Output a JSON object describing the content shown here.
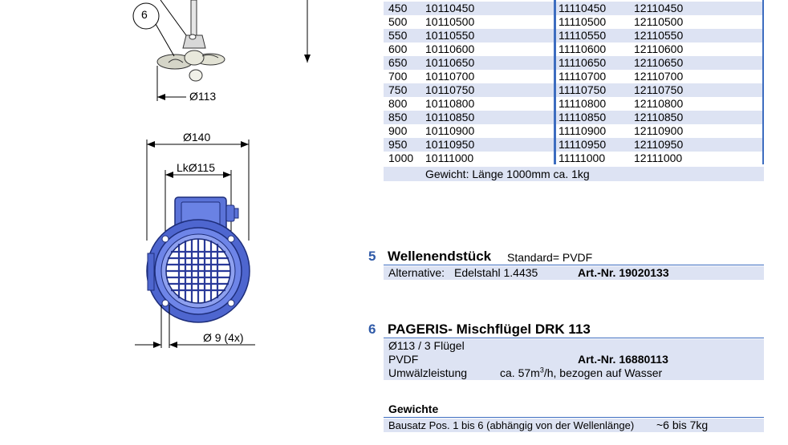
{
  "drawing": {
    "item_bubble": "6",
    "mixer_diameter": "Ø113",
    "motor_diameter": "Ø140",
    "bolt_circle": "LkØ115",
    "hole_spec": "Ø 9 (4x)"
  },
  "shaft_table": {
    "rows": [
      {
        "length": "450",
        "a": "10110450",
        "b": "11110450",
        "c": "12110450"
      },
      {
        "length": "500",
        "a": "10110500",
        "b": "11110500",
        "c": "12110500"
      },
      {
        "length": "550",
        "a": "10110550",
        "b": "11110550",
        "c": "12110550"
      },
      {
        "length": "600",
        "a": "10110600",
        "b": "11110600",
        "c": "12110600"
      },
      {
        "length": "650",
        "a": "10110650",
        "b": "11110650",
        "c": "12110650"
      },
      {
        "length": "700",
        "a": "10110700",
        "b": "11110700",
        "c": "12110700"
      },
      {
        "length": "750",
        "a": "10110750",
        "b": "11110750",
        "c": "12110750"
      },
      {
        "length": "800",
        "a": "10110800",
        "b": "11110800",
        "c": "12110800"
      },
      {
        "length": "850",
        "a": "10110850",
        "b": "11110850",
        "c": "12110850"
      },
      {
        "length": "900",
        "a": "10110900",
        "b": "11110900",
        "c": "12110900"
      },
      {
        "length": "950",
        "a": "10110950",
        "b": "11110950",
        "c": "12110950"
      },
      {
        "length": "1000",
        "a": "10111000",
        "b": "11111000",
        "c": "12111000"
      }
    ],
    "weight_note": "Gewicht: Länge 1000mm ca. 1kg"
  },
  "section5": {
    "number": "5",
    "title": "Wellenendstück",
    "subtitle": "Standard= PVDF",
    "alt_label": "Alternative:",
    "alt_material": "Edelstahl 1.4435",
    "art_nr": "Art.-Nr. 19020133"
  },
  "section6": {
    "number": "6",
    "title": "PAGERIS- Mischflügel DRK 113",
    "line1": "Ø113 / 3 Flügel",
    "material": "PVDF",
    "art_nr": "Art.-Nr. 16880113",
    "flow_label": "Umwälzleistung",
    "flow_value_pre": "ca. 57m",
    "flow_value_sup": "3",
    "flow_value_post": "/h, bezogen auf Wasser"
  },
  "weights": {
    "heading": "Gewichte",
    "label": "Bausatz  Pos. 1 bis 6 (abhängig von der Wellenlänge)",
    "value": "~6 bis 7kg"
  },
  "colors": {
    "accent": "#3d6dc0",
    "motor_blue": "#5b73d8",
    "shade": "#dde3f3"
  }
}
